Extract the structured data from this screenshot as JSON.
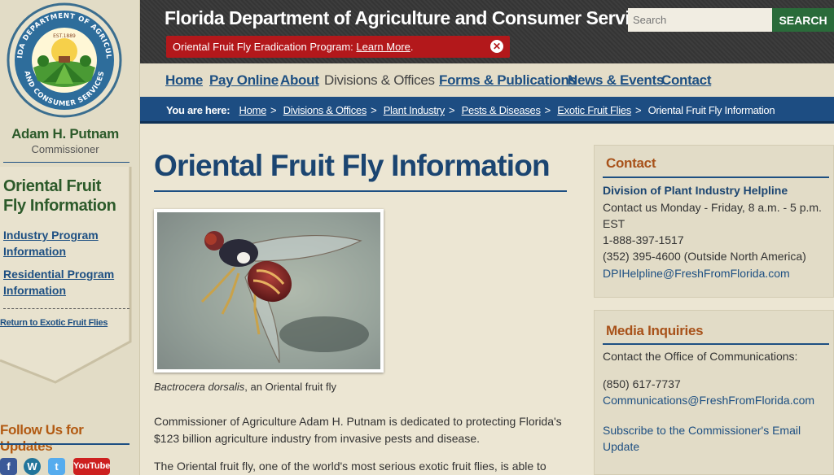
{
  "colors": {
    "brand_blue": "#1d4f82",
    "brand_green": "#2c5a2a",
    "alert_red": "#b3181b",
    "accent_orange": "#a8521a",
    "background": "#ece6d3"
  },
  "seal": {
    "text_top": "FLORIDA DEPARTMENT OF AGRICULTURE",
    "text_bottom": "AND CONSUMER SERVICES",
    "est": "EST.1889"
  },
  "sidebar": {
    "person_name": "Adam H. Putnam",
    "person_title": "Commissioner",
    "section_title": "Oriental Fruit Fly Information",
    "links": [
      {
        "label": "Industry Program Information"
      },
      {
        "label": "Residential Program Information"
      }
    ],
    "return_link": "Return to Exotic Fruit Flies",
    "follow_title": "Follow Us for Updates",
    "social": [
      {
        "icon": "facebook-icon",
        "glyph": "f",
        "color": "#3b5998"
      },
      {
        "icon": "wordpress-icon",
        "glyph": "W",
        "color": "#21759b"
      },
      {
        "icon": "twitter-icon",
        "glyph": "t",
        "color": "#55acee"
      },
      {
        "icon": "youtube-icon",
        "glyph": "YouTube",
        "color": "#cd201f"
      }
    ]
  },
  "header": {
    "site_title": "Florida Department of Agriculture and Consumer Services",
    "alert_text": "Oriental Fruit Fly Eradication Program: ",
    "alert_link": "Learn More",
    "alert_suffix": ".",
    "alert_close_icon": "close-circle-icon",
    "search_placeholder": "Search",
    "search_button": "SEARCH"
  },
  "nav": {
    "items": [
      {
        "label": "Home"
      },
      {
        "label": "Pay Online"
      },
      {
        "label": "About"
      },
      {
        "label": "Divisions & Offices"
      },
      {
        "label": "Forms & Publications"
      },
      {
        "label": "News & Events"
      },
      {
        "label": "Contact"
      }
    ]
  },
  "breadcrumb": {
    "label": "You are here:",
    "items": [
      "Home",
      "Divisions & Offices",
      "Plant Industry",
      "Pests & Diseases",
      "Exotic Fruit Flies"
    ],
    "current": "Oriental Fruit Fly Information",
    "separator": ">"
  },
  "main": {
    "title": "Oriental Fruit Fly Information",
    "caption_species": "Bactrocera dorsalis",
    "caption_rest": ", an Oriental fruit fly",
    "para1": "Commissioner of Agriculture Adam H. Putnam is dedicated to protecting Florida's $123 billion agriculture industry from invasive pests and disease.",
    "para2": "The Oriental fruit fly, one of the world's most serious exotic fruit flies, is able to"
  },
  "contact_box": {
    "title": "Contact",
    "org": "Division of Plant Industry Helpline",
    "hours_line1": "Contact us Monday - Friday, 8 a.m. - 5 p.m.",
    "hours_line2": "EST",
    "phone1": "1-888-397-1517",
    "phone2": "(352) 395-4600 (Outside North America)",
    "email": "DPIHelpline@FreshFromFlorida.com"
  },
  "media_box": {
    "title": "Media Inquiries",
    "line1": "Contact the Office of Communications:",
    "phone": "(850) 617-7737",
    "email": "Communications@FreshFromFlorida.com",
    "subscribe_line1": "Subscribe to the Commissioner's Email",
    "subscribe_line2": "Update"
  }
}
